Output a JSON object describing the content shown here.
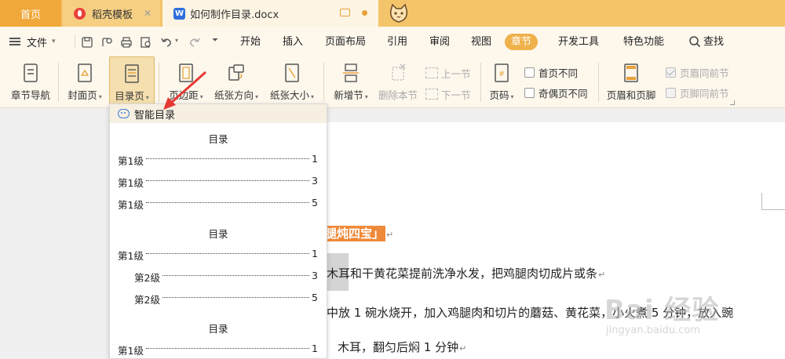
{
  "tabs": {
    "home": "首页",
    "template": "稻壳模板",
    "document": "如何制作目录.docx",
    "doc_icon_letter": "W"
  },
  "menubar": {
    "file": "文件",
    "tabs": [
      "开始",
      "插入",
      "页面布局",
      "引用",
      "审阅",
      "视图",
      "章节",
      "开发工具",
      "特色功能"
    ],
    "active_tab": "章节",
    "search": "查找"
  },
  "ribbon": {
    "chapter_nav": "章节导航",
    "cover_page": "封面页",
    "toc_page": "目录页",
    "margins": "页边距",
    "orientation": "纸张方向",
    "paper_size": "纸张大小",
    "new_section": "新增节",
    "delete_section": "删除本节",
    "prev_section": "上一节",
    "next_section": "下一节",
    "page_number": "页码",
    "first_page_diff": "首页不同",
    "odd_even_diff": "奇偶页不同",
    "header_footer": "页眉和页脚",
    "header_same_prev": "页眉同前节",
    "footer_same_prev": "页脚同前节",
    "header_same_prev_checked": true,
    "footer_same_prev_checked": false
  },
  "dropdown": {
    "smart_toc": "智能目录",
    "tables": [
      {
        "title": "目录",
        "rows": [
          {
            "level": "第1级",
            "page": "1"
          },
          {
            "level": "第1级",
            "page": "3"
          },
          {
            "level": "第1级",
            "page": "5"
          }
        ]
      },
      {
        "title": "目录",
        "rows": [
          {
            "level": "第1级",
            "page": "1"
          },
          {
            "level": "第2级",
            "page": "3"
          },
          {
            "level": "第2级",
            "page": "5"
          }
        ]
      },
      {
        "title": "目录",
        "rows": [
          {
            "level": "第1级",
            "page": "1"
          }
        ]
      }
    ]
  },
  "document": {
    "heading_fragment": "腿炖四宝」",
    "line1": "木耳和干黄花菜提前洗净水发，把鸡腿肉切成片或条",
    "line2": "中放 1 碗水烧开，加入鸡腿肉和切片的蘑菇、黄花菜，小火煮 5 分钟，放入豌",
    "line3": "木耳，翻匀后焖 1 分钟"
  },
  "watermark": {
    "main": "Bai 经验",
    "sub": "jingyan.baidu.com"
  },
  "colors": {
    "tabbar": "#f3c46a",
    "active_tab": "#efb14a",
    "heading_highlight": "#ef8a3a",
    "arrow": "#e53935"
  }
}
